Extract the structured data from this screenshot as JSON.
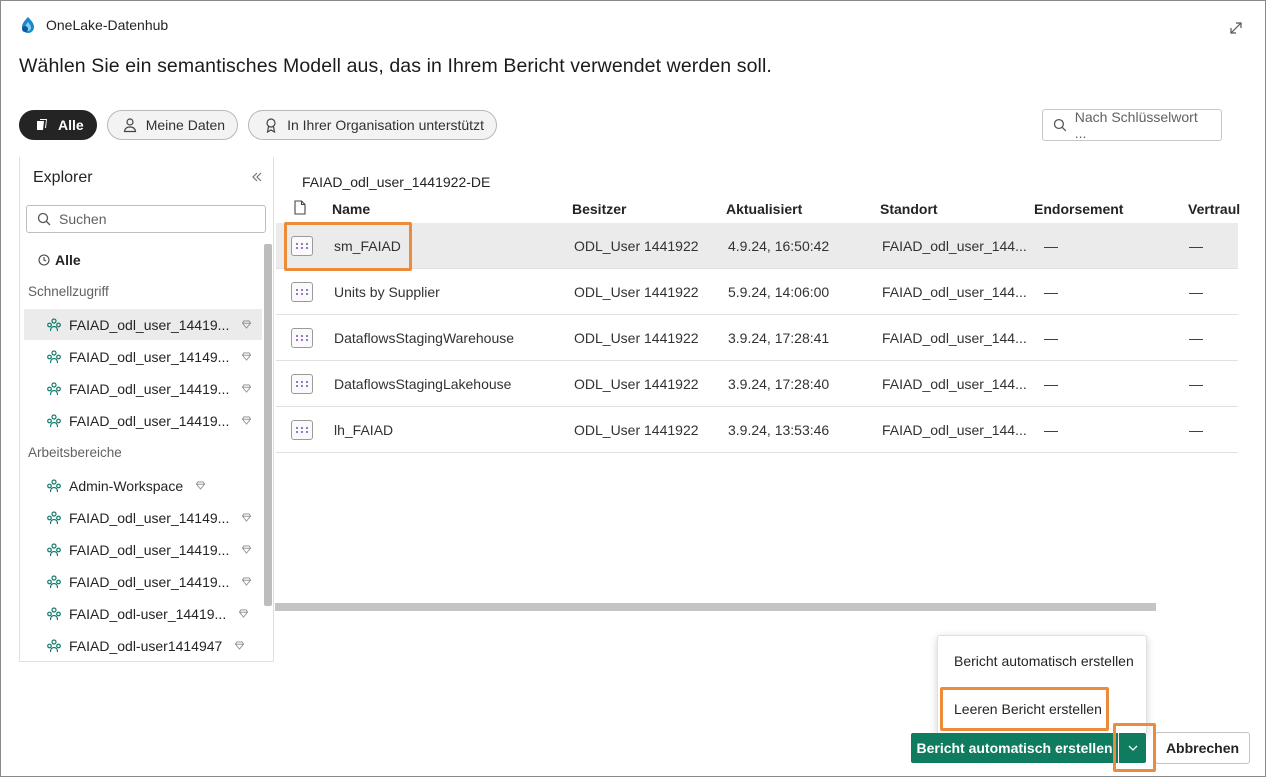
{
  "app": {
    "title": "OneLake-Datenhub"
  },
  "dialog": {
    "heading": "Wählen Sie ein semantisches Modell aus, das in Ihrem Bericht verwendet werden soll."
  },
  "filters": [
    {
      "label": "Alle",
      "active": true,
      "icon": "layers-icon"
    },
    {
      "label": "Meine Daten",
      "active": false,
      "icon": "person-icon"
    },
    {
      "label": "In Ihrer Organisation unterstützt",
      "active": false,
      "icon": "ribbon-icon"
    }
  ],
  "search": {
    "placeholder": "Nach Schlüsselwort ..."
  },
  "explorer": {
    "title": "Explorer",
    "search_placeholder": "Suchen",
    "all_label": "Alle",
    "quick_access_label": "Schnellzugriff",
    "quick_access": [
      {
        "label": "FAIAD_odl_user_14419..."
      },
      {
        "label": "FAIAD_odl_user_14149..."
      },
      {
        "label": "FAIAD_odl_user_14419..."
      },
      {
        "label": "FAIAD_odl_user_14419..."
      }
    ],
    "workspaces_label": "Arbeitsbereiche",
    "workspaces": [
      {
        "label": "Admin-Workspace"
      },
      {
        "label": "FAIAD_odl_user_14149..."
      },
      {
        "label": "FAIAD_odl_user_14419..."
      },
      {
        "label": "FAIAD_odl_user_14419..."
      },
      {
        "label": "FAIAD_odl-user_14419..."
      },
      {
        "label": "FAIAD_odl-user1414947"
      }
    ]
  },
  "table": {
    "breadcrumb": "FAIAD_odl_user_1441922-DE",
    "columns": [
      "Name",
      "Besitzer",
      "Aktualisiert",
      "Standort",
      "Endorsement",
      "Vertraul"
    ],
    "rows": [
      {
        "name": "sm_FAIAD",
        "owner": "ODL_User 1441922",
        "updated": "4.9.24, 16:50:42",
        "location": "FAIAD_odl_user_144...",
        "endorsement": "—",
        "sensitivity": "—"
      },
      {
        "name": "Units by Supplier",
        "owner": "ODL_User 1441922",
        "updated": "5.9.24, 14:06:00",
        "location": "FAIAD_odl_user_144...",
        "endorsement": "—",
        "sensitivity": "—"
      },
      {
        "name": "DataflowsStagingWarehouse",
        "owner": "ODL_User 1441922",
        "updated": "3.9.24, 17:28:41",
        "location": "FAIAD_odl_user_144...",
        "endorsement": "—",
        "sensitivity": "—"
      },
      {
        "name": "DataflowsStagingLakehouse",
        "owner": "ODL_User 1441922",
        "updated": "3.9.24, 17:28:40",
        "location": "FAIAD_odl_user_144...",
        "endorsement": "—",
        "sensitivity": "—"
      },
      {
        "name": "lh_FAIAD",
        "owner": "ODL_User 1441922",
        "updated": "3.9.24, 13:53:46",
        "location": "FAIAD_odl_user_144...",
        "endorsement": "—",
        "sensitivity": "—"
      }
    ]
  },
  "menu": {
    "items": [
      "Bericht automatisch erstellen",
      "Leeren Bericht erstellen"
    ]
  },
  "footer": {
    "primary_label": "Bericht automatisch erstellen",
    "cancel_label": "Abbrechen"
  },
  "colors": {
    "accent": "#0f7b5f",
    "highlight": "#ec8b3a",
    "workspace_icon": "#0f7b6c"
  }
}
